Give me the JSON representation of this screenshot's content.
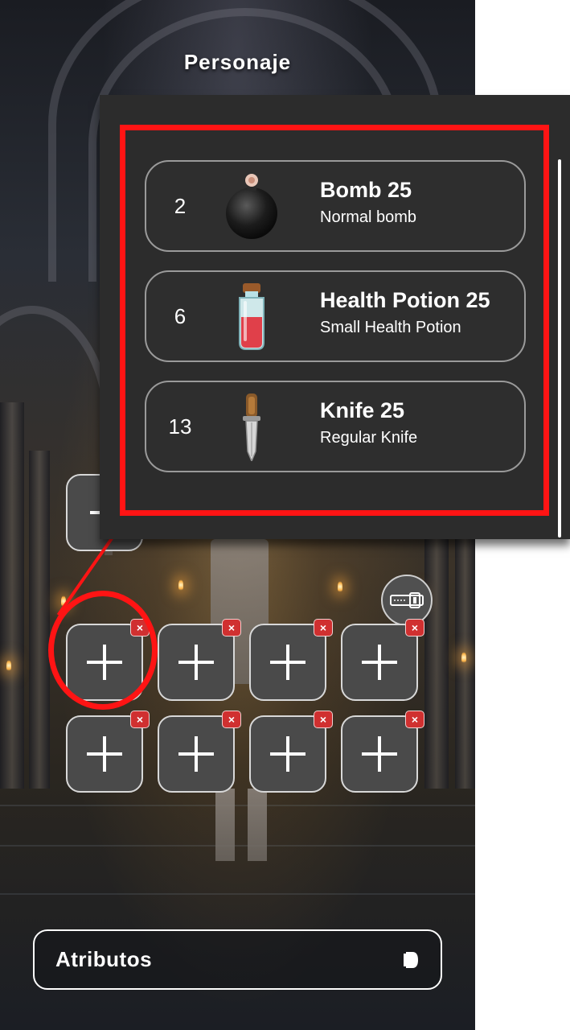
{
  "screen_title": "Personaje",
  "inventory": {
    "items": [
      {
        "quantity": "2",
        "name": "Bomb 25",
        "description": "Normal bomb",
        "icon": "bomb-icon"
      },
      {
        "quantity": "6",
        "name": "Health Potion 25",
        "description": "Small Health Potion",
        "icon": "health-potion-icon"
      },
      {
        "quantity": "13",
        "name": "Knife 25",
        "description": "Regular Knife",
        "icon": "knife-icon"
      }
    ]
  },
  "slots": {
    "remove_glyph": "×",
    "count": 8
  },
  "attributes_button": {
    "label": "Atributos",
    "icon": "arrow-right-icon"
  },
  "colors": {
    "highlight": "#ff1414",
    "panel": "#2c2c2c",
    "slot": "#4a4a4a",
    "remove_badge": "#d03030"
  }
}
